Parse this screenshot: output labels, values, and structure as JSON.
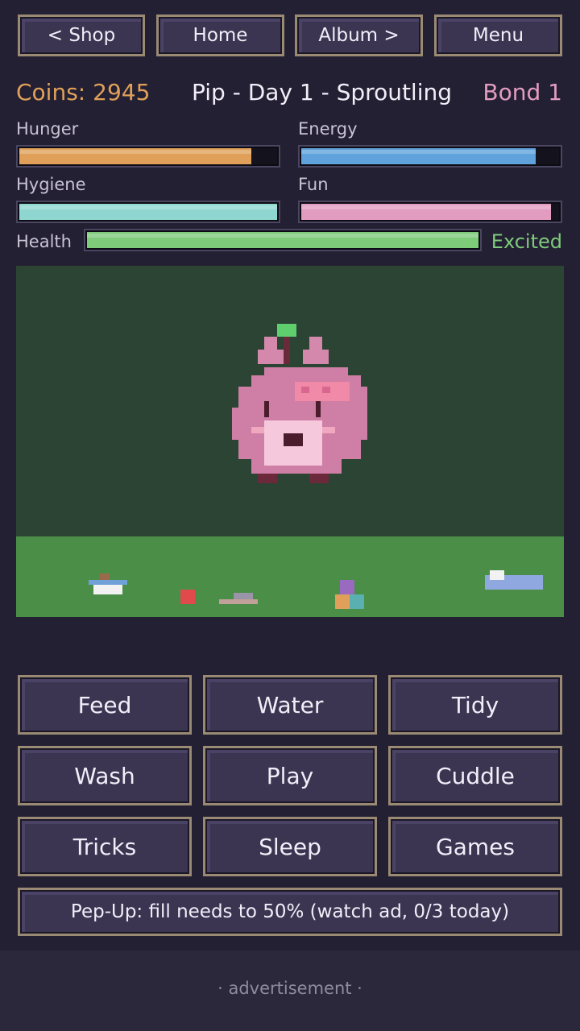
{
  "nav": {
    "shop": "< Shop",
    "home": "Home",
    "album": "Album >",
    "menu": "Menu"
  },
  "header": {
    "coins": "Coins: 2945",
    "title": "Pip - Day 1 - Sproutling",
    "bond": "Bond 1"
  },
  "stats": {
    "hunger": {
      "label": "Hunger",
      "value": 0.9,
      "color": "#e0a05a"
    },
    "energy": {
      "label": "Energy",
      "value": 0.91,
      "color": "#5fa2dc"
    },
    "hygiene": {
      "label": "Hygiene",
      "value": 1.0,
      "color": "#8fd6d0"
    },
    "fun": {
      "label": "Fun",
      "value": 0.97,
      "color": "#e29cc0"
    },
    "health": {
      "label": "Health",
      "value": 1.0,
      "color": "#7ecb7a"
    }
  },
  "mood": {
    "text": "Excited",
    "color": "#7ecb7a"
  },
  "actions": {
    "feed": "Feed",
    "water": "Water",
    "tidy": "Tidy",
    "wash": "Wash",
    "play": "Play",
    "cuddle": "Cuddle",
    "tricks": "Tricks",
    "sleep": "Sleep",
    "games": "Games"
  },
  "pepup": "Pep-Up: fill needs to 50%  (watch ad, 0/3 today)",
  "ad": "· advertisement ·"
}
